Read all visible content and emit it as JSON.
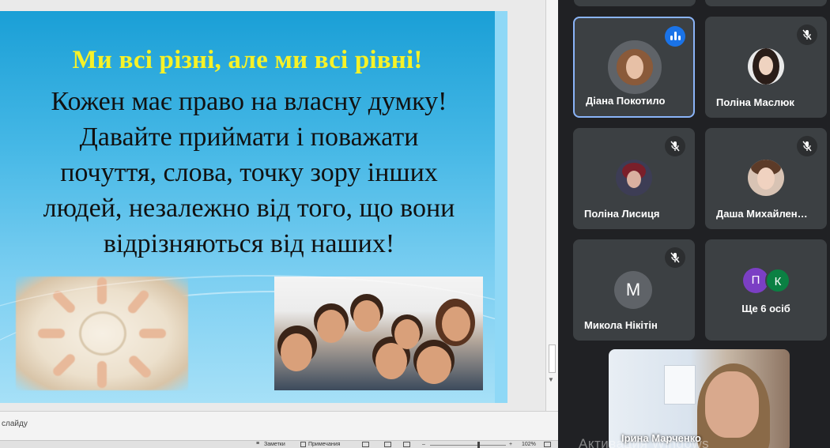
{
  "slide": {
    "title": "Ми всі різні, але ми всі рівні!",
    "body_lines": [
      "Кожен має право на власну думку!",
      "Давайте приймати і поважати",
      "почуття, слова, точку зору інших",
      "людей, незалежно від того, що вони",
      "відрізняються від наших!"
    ]
  },
  "notes_bar": {
    "hint": "слайду"
  },
  "status_bar": {
    "notes_label": "Заметки",
    "comments_label": "Примечания",
    "zoom": "102%",
    "minus": "–",
    "plus": "+"
  },
  "participants": [
    {
      "name": "Діана Покотило",
      "state": "speaking"
    },
    {
      "name": "Поліна Маслюк",
      "state": "muted"
    },
    {
      "name": "Поліна Лисиця",
      "state": "muted"
    },
    {
      "name": "Даша Михайлен…",
      "state": "muted"
    },
    {
      "name": "Микола Нікітін",
      "state": "muted",
      "initial": "М"
    }
  ],
  "more": {
    "initials": [
      "П",
      "К"
    ],
    "label": "Ще 6 осіб"
  },
  "presenter": {
    "name": "Ірина Марченко"
  },
  "watermark": "Активация Windows",
  "colors": {
    "tile_bg": "#3c4043",
    "active_border": "#8ab4f8",
    "speak_blue": "#1a73e8",
    "title_yellow": "#f7f227",
    "initial_p": "#7b3fc4",
    "initial_k": "#0b8043"
  }
}
